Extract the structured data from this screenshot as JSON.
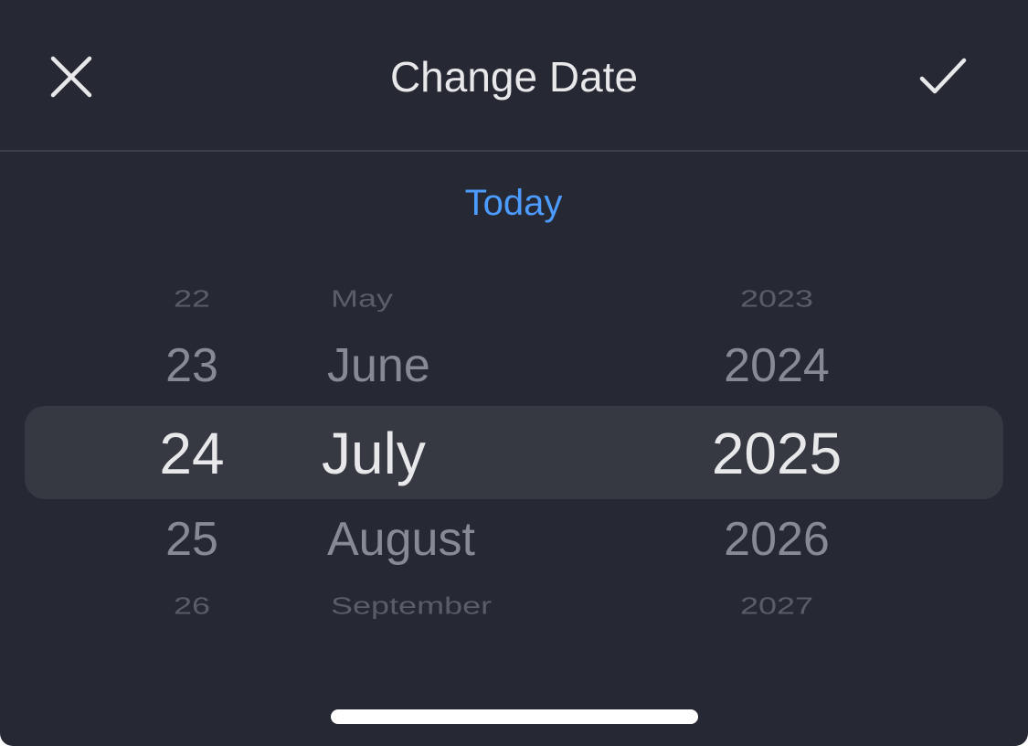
{
  "header": {
    "title": "Change Date",
    "close_icon": "close-icon",
    "confirm_icon": "checkmark-icon"
  },
  "today_label": "Today",
  "picker": {
    "days": [
      "22",
      "23",
      "24",
      "25",
      "26"
    ],
    "months": [
      "May",
      "June",
      "July",
      "August",
      "September"
    ],
    "years": [
      "2023",
      "2024",
      "2025",
      "2026",
      "2027"
    ],
    "selected": {
      "day": "24",
      "month": "July",
      "year": "2025"
    }
  },
  "colors": {
    "background": "#262833",
    "accent": "#4c9bff",
    "text_primary": "#e8e8ea",
    "selection_band": "#363842"
  }
}
